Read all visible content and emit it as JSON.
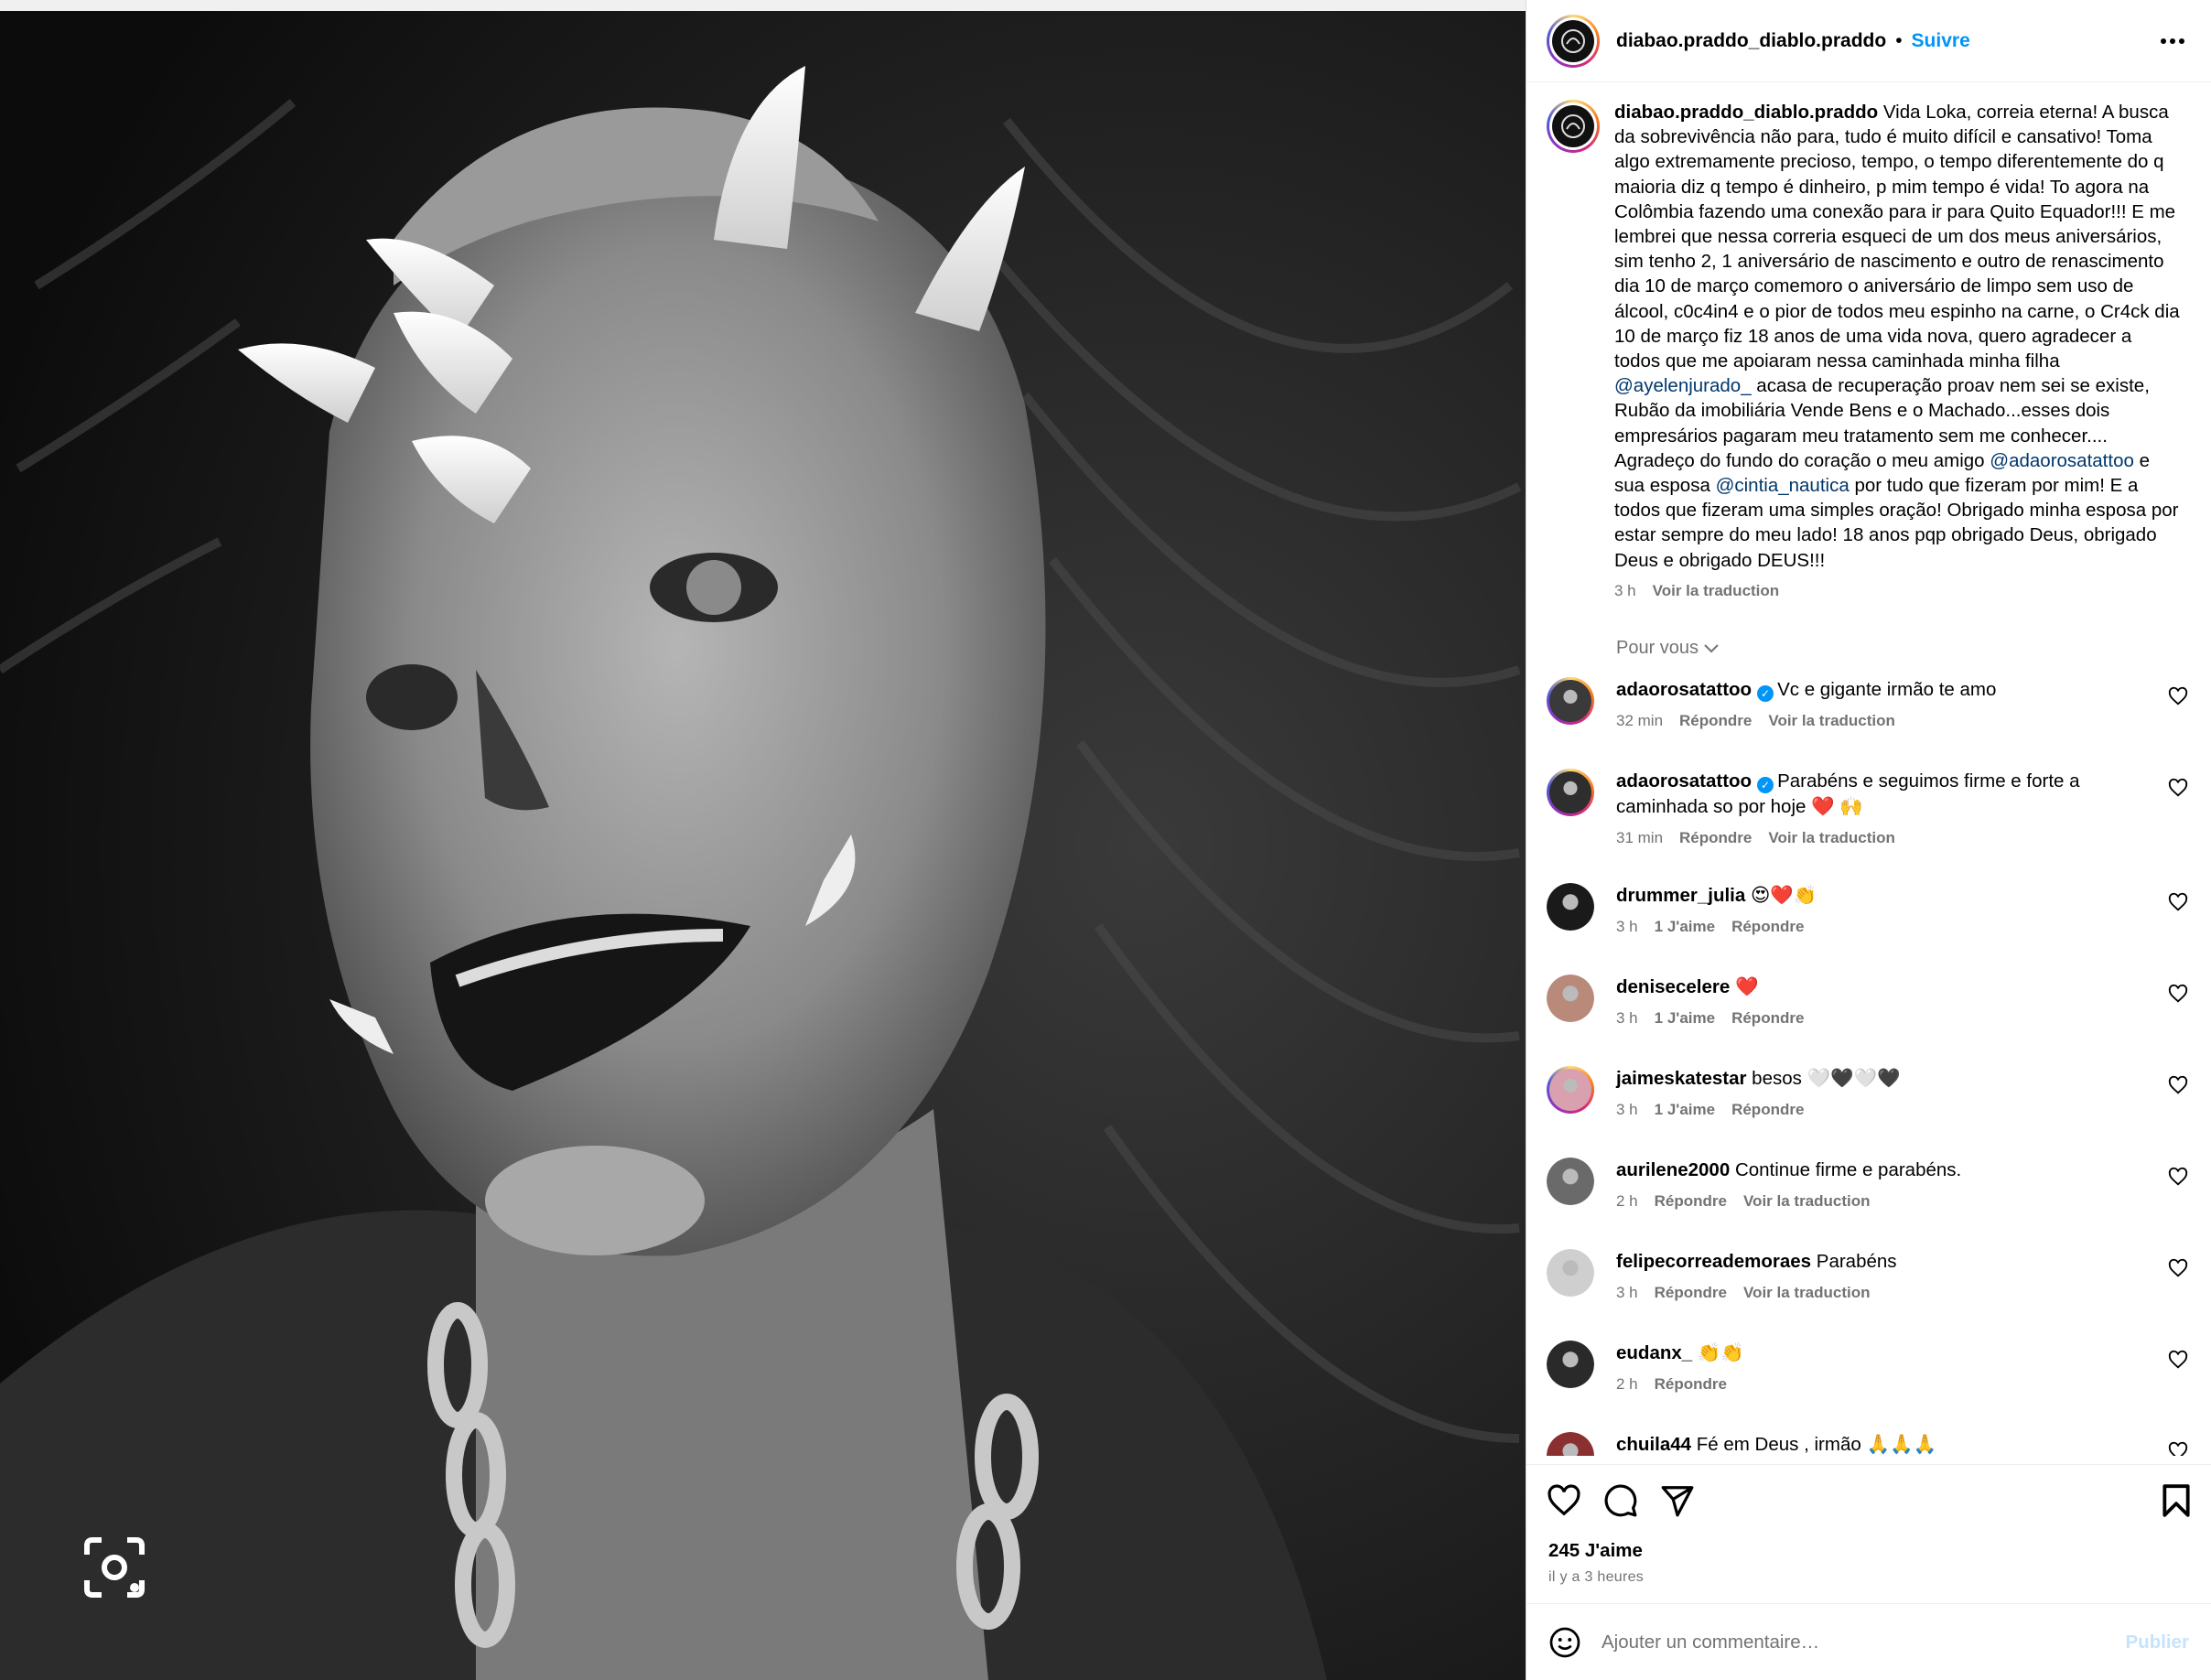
{
  "post": {
    "username": "diabao.praddo_diablo.praddo",
    "separator": "•",
    "follow_label": "Suivre",
    "more_icon": "more-horizontal-icon"
  },
  "caption": {
    "username": "diabao.praddo_diablo.praddo",
    "text_1": " Vida Loka, correia eterna! A busca da sobrevivência não para, tudo é muito difícil e cansativo! Toma algo extremamente precioso, tempo, o tempo diferentemente do q maioria diz q tempo é dinheiro, p mim tempo é vida! To agora na Colômbia fazendo uma conexão para ir para Quito Equador!!! E me lembrei que nessa correria esqueci de um dos meus aniversários, sim tenho 2, 1 aniversário de nascimento e outro de renascimento dia 10 de março comemoro o aniversário de limpo sem uso de álcool, c0c4in4 e o pior de todos meu espinho na carne, o Cr4ck dia 10 de março fiz 18 anos de uma vida nova, quero agradecer a todos que me apoiaram nessa caminhada minha filha ",
    "mention_1": "@ayelenjurado_",
    "text_2": " acasa de recuperação proav nem sei se existe, Rubão da imobiliária Vende Bens e o Machado...esses dois empresários pagaram meu tratamento sem me conhecer.... Agradeço do fundo do coração o meu amigo ",
    "mention_2": "@adaorosatattoo",
    "text_3": " e sua esposa ",
    "mention_3": "@cintia_nautica",
    "text_4": " por tudo que fizeram por mim! E a todos que fizeram uma simples oração! Obrigado minha esposa por estar sempre do meu lado! 18 anos pqp obrigado Deus, obrigado Deus e obrigado DEUS!!!",
    "time": "3 h",
    "translate": "Voir la traduction"
  },
  "for_you_label": "Pour vous",
  "comments": [
    {
      "username": "adaorosatattoo",
      "verified": true,
      "text": "Vc e gigante irmão te amo",
      "time": "32 min",
      "likes": "",
      "reply": "Répondre",
      "translate": "Voir la traduction"
    },
    {
      "username": "adaorosatattoo",
      "verified": true,
      "text": "Parabéns e seguimos firme e forte a caminhada so por hoje ❤️ 🙌",
      "time": "31 min",
      "likes": "",
      "reply": "Répondre",
      "translate": "Voir la traduction"
    },
    {
      "username": "drummer_julia",
      "verified": false,
      "text": "😍❤️👏",
      "time": "3 h",
      "likes": "1 J'aime",
      "reply": "Répondre",
      "translate": ""
    },
    {
      "username": "denisecelere",
      "verified": false,
      "text": "❤️",
      "time": "3 h",
      "likes": "1 J'aime",
      "reply": "Répondre",
      "translate": ""
    },
    {
      "username": "jaimeskatestar",
      "verified": false,
      "text": "besos 🤍🖤🤍🖤",
      "time": "3 h",
      "likes": "1 J'aime",
      "reply": "Répondre",
      "translate": ""
    },
    {
      "username": "aurilene2000",
      "verified": false,
      "text": "Continue firme e parabéns.",
      "time": "2 h",
      "likes": "",
      "reply": "Répondre",
      "translate": "Voir la traduction"
    },
    {
      "username": "felipecorreademoraes",
      "verified": false,
      "text": "Parabéns",
      "time": "3 h",
      "likes": "",
      "reply": "Répondre",
      "translate": "Voir la traduction"
    },
    {
      "username": "eudanx_",
      "verified": false,
      "text": "👏👏",
      "time": "2 h",
      "likes": "",
      "reply": "Répondre",
      "translate": ""
    },
    {
      "username": "chuila44",
      "verified": false,
      "text": "Fé em Deus , irmão 🙏🙏🙏",
      "time": "",
      "likes": "",
      "reply": "",
      "translate": ""
    }
  ],
  "actions": {
    "like_icon": "heart-icon",
    "comment_icon": "comment-icon",
    "share_icon": "send-icon",
    "save_icon": "bookmark-icon",
    "likes": "245 J'aime",
    "time_ago": "il y a 3 heures"
  },
  "add_comment": {
    "placeholder": "Ajouter un commentaire…",
    "publish": "Publier"
  },
  "colors": {
    "link_blue": "#0095f6",
    "mention": "#00376b",
    "secondary_text": "#737373",
    "publish_disabled": "#c7e3fb"
  }
}
